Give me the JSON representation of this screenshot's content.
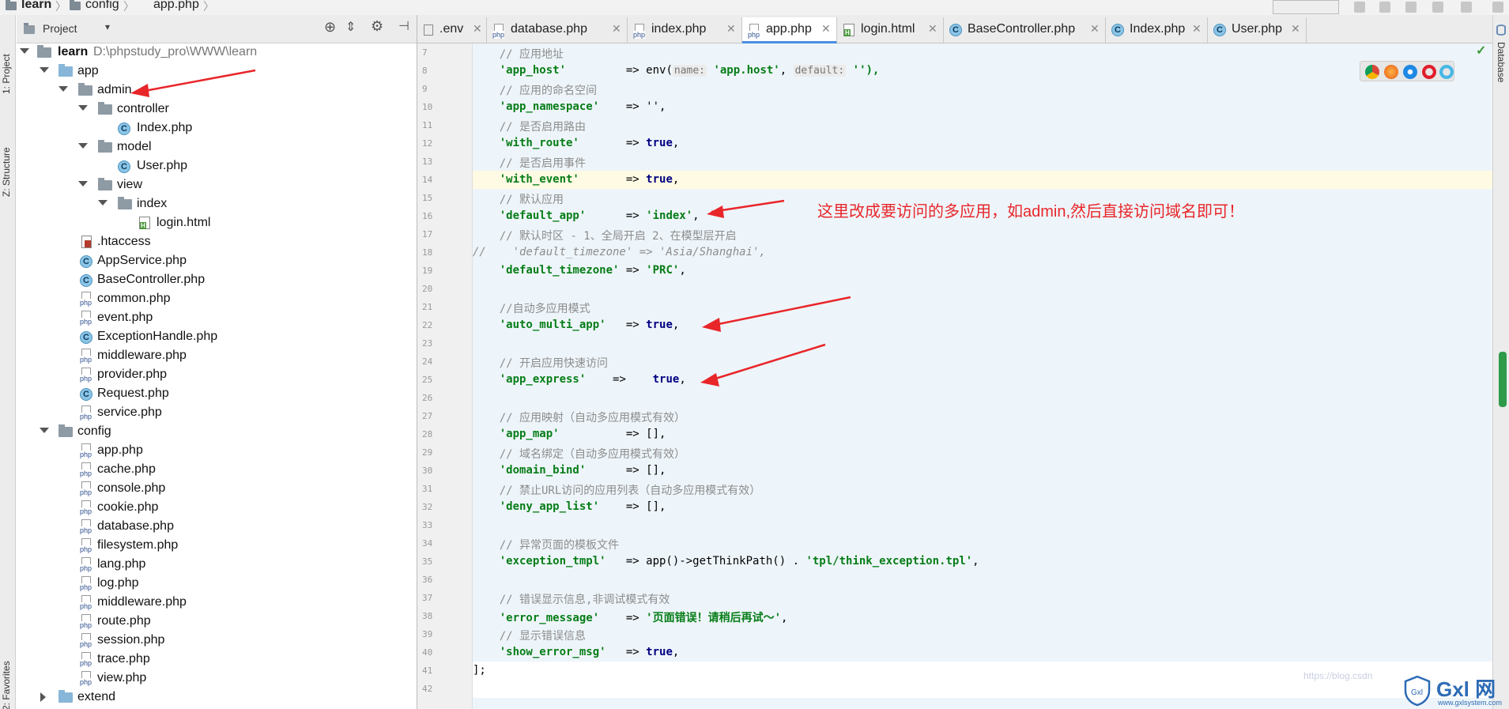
{
  "breadcrumb": {
    "items": [
      "learn",
      "config",
      "app.php"
    ]
  },
  "left_strip": {
    "project_tab": "1: Project",
    "structure_tab": "Z: Structure",
    "favorites_tab": "2: Favorites"
  },
  "right_strip": {
    "database_tab": "Database"
  },
  "project_panel": {
    "title": "Project",
    "dropdown_icon": "chevron-down-icon"
  },
  "tree": {
    "root_name": "learn",
    "root_path": "D:\\phpstudy_pro\\WWW\\learn",
    "app": "app",
    "admin": "admin",
    "controller": "controller",
    "controller_index": "Index.php",
    "model": "model",
    "model_user": "User.php",
    "view": "view",
    "view_index": "index",
    "login_html": "login.html",
    "app_files": [
      ".htaccess",
      "AppService.php",
      "BaseController.php",
      "common.php",
      "event.php",
      "ExceptionHandle.php",
      "middleware.php",
      "provider.php",
      "Request.php",
      "service.php"
    ],
    "config": "config",
    "config_files": [
      "app.php",
      "cache.php",
      "console.php",
      "cookie.php",
      "database.php",
      "filesystem.php",
      "lang.php",
      "log.php",
      "middleware.php",
      "route.php",
      "session.php",
      "trace.php",
      "view.php"
    ],
    "extend": "extend"
  },
  "tabs": [
    {
      "label": ".env"
    },
    {
      "label": "database.php"
    },
    {
      "label": "index.php"
    },
    {
      "label": "app.php",
      "active": true
    },
    {
      "label": "login.html"
    },
    {
      "label": "BaseController.php"
    },
    {
      "label": "Index.php"
    },
    {
      "label": "User.php"
    }
  ],
  "editor": {
    "line_numbers": [
      "7",
      "8",
      "9",
      "10",
      "11",
      "12",
      "13",
      "14",
      "15",
      "16",
      "17",
      "18",
      "19",
      "20",
      "21",
      "22",
      "23",
      "24",
      "25",
      "26",
      "27",
      "28",
      "29",
      "30",
      "31",
      "32",
      "33",
      "34",
      "35",
      "36",
      "37",
      "38",
      "39",
      "40",
      "41",
      "42"
    ],
    "l7": "    // 应用地址",
    "l8_key": "    'app_host'",
    "l8_arrow": "         => env(",
    "l8_hint1": "name:",
    "l8_val": " 'app.host'",
    "l8_comma": ", ",
    "l8_hint2": "default:",
    "l8_end": " ''),",
    "l9": "    // 应用的命名空间",
    "l10_key": "    'app_namespace'",
    "l10_rest": "    => '',",
    "l11": "    // 是否启用路由",
    "l12_key": "    'with_route'",
    "l12_arrow": "       => ",
    "l12_val": "true",
    "l12_end": ",",
    "l13": "    // 是否启用事件",
    "l14_key": "    'with_event'",
    "l14_arrow": "       => ",
    "l14_val": "true",
    "l14_end": ",",
    "l15": "    // 默认应用",
    "l16_key": "    'default_app'",
    "l16_arrow": "      => ",
    "l16_val": "'index'",
    "l16_end": ",",
    "l17": "    // 默认时区 - 1、全局开启 2、在模型层开启",
    "l18": "//    'default_timezone' => 'Asia/Shanghai',",
    "l19_key": "    'default_timezone'",
    "l19_arrow": " => ",
    "l19_val": "'PRC'",
    "l19_end": ",",
    "l21": "    //自动多应用模式",
    "l22_key": "    'auto_multi_app'",
    "l22_arrow": "   => ",
    "l22_val": "true",
    "l22_end": ",",
    "l24": "    // 开启应用快速访问",
    "l25_key": "    'app_express'",
    "l25_arrow": "    =>    ",
    "l25_val": "true",
    "l25_end": ",",
    "l27": "    // 应用映射（自动多应用模式有效）",
    "l28_key": "    'app_map'",
    "l28_rest": "          => [],",
    "l29": "    // 域名绑定（自动多应用模式有效）",
    "l30_key": "    'domain_bind'",
    "l30_rest": "      => [],",
    "l31": "    // 禁止URL访问的应用列表（自动多应用模式有效）",
    "l32_key": "    'deny_app_list'",
    "l32_rest": "    => [],",
    "l34": "    // 异常页面的模板文件",
    "l35_key": "    'exception_tmpl'",
    "l35_mid": "   => app()->getThinkPath() . ",
    "l35_val": "'tpl/think_exception.tpl'",
    "l35_end": ",",
    "l37": "    // 错误显示信息,非调试模式有效",
    "l38_key": "    'error_message'",
    "l38_arrow": "    => ",
    "l38_val": "'页面错误！请稍后再试～'",
    "l38_end": ",",
    "l39": "    // 显示错误信息",
    "l40_key": "    'show_error_msg'",
    "l40_arrow": "   => ",
    "l40_val": "true",
    "l40_end": ",",
    "l41": "];"
  },
  "annotation": "这里改成要访问的多应用，如admin,然后直接访问域名即可！",
  "watermark": "https://blog.csdn",
  "logo": {
    "text": "Gxl 网",
    "sub": "www.gxlsystem.com"
  },
  "colors": {
    "annotation": "#e8262a",
    "string": "#067d17",
    "keyword": "#000080",
    "comment": "#8c8c8c",
    "tab_active": "#4a8ee0"
  }
}
